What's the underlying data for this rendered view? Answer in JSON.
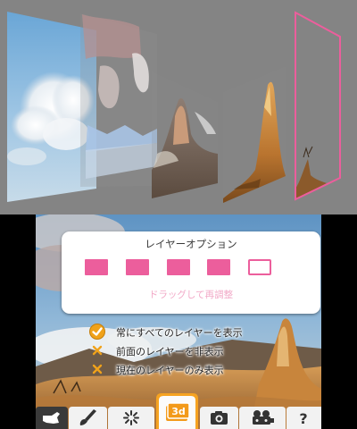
{
  "layer_options": {
    "title": "レイヤーオプション",
    "slots": [
      {
        "name": "layer-1",
        "selected": false
      },
      {
        "name": "layer-2",
        "selected": false
      },
      {
        "name": "layer-3",
        "selected": false
      },
      {
        "name": "layer-4",
        "selected": false
      },
      {
        "name": "layer-5",
        "selected": true
      }
    ],
    "hint": "ドラッグして再調整"
  },
  "menu": {
    "items": [
      {
        "label": "常にすべてのレイヤーを表示",
        "icon": "check-icon",
        "checked": true
      },
      {
        "label": "前面のレイヤーを非表示",
        "icon": "x-icon",
        "checked": false
      },
      {
        "label": "現在のレイヤーのみ表示",
        "icon": "x-icon",
        "checked": false
      }
    ]
  },
  "toolbar": {
    "tools": [
      {
        "icon": "hand-pointer-icon",
        "active": false
      },
      {
        "icon": "brush-icon",
        "active": false
      },
      {
        "icon": "sparkle-icon",
        "active": false
      },
      {
        "icon": "layers-3d-icon",
        "label": "3d",
        "active": true
      },
      {
        "icon": "camera-icon",
        "active": false
      },
      {
        "icon": "reels-icon",
        "active": false
      },
      {
        "icon": "help-icon",
        "label": "?",
        "active": false
      }
    ]
  },
  "colors": {
    "accent_pink": "#ec5e9c",
    "check_orange": "#f0a21a",
    "top_background": "#848484"
  }
}
